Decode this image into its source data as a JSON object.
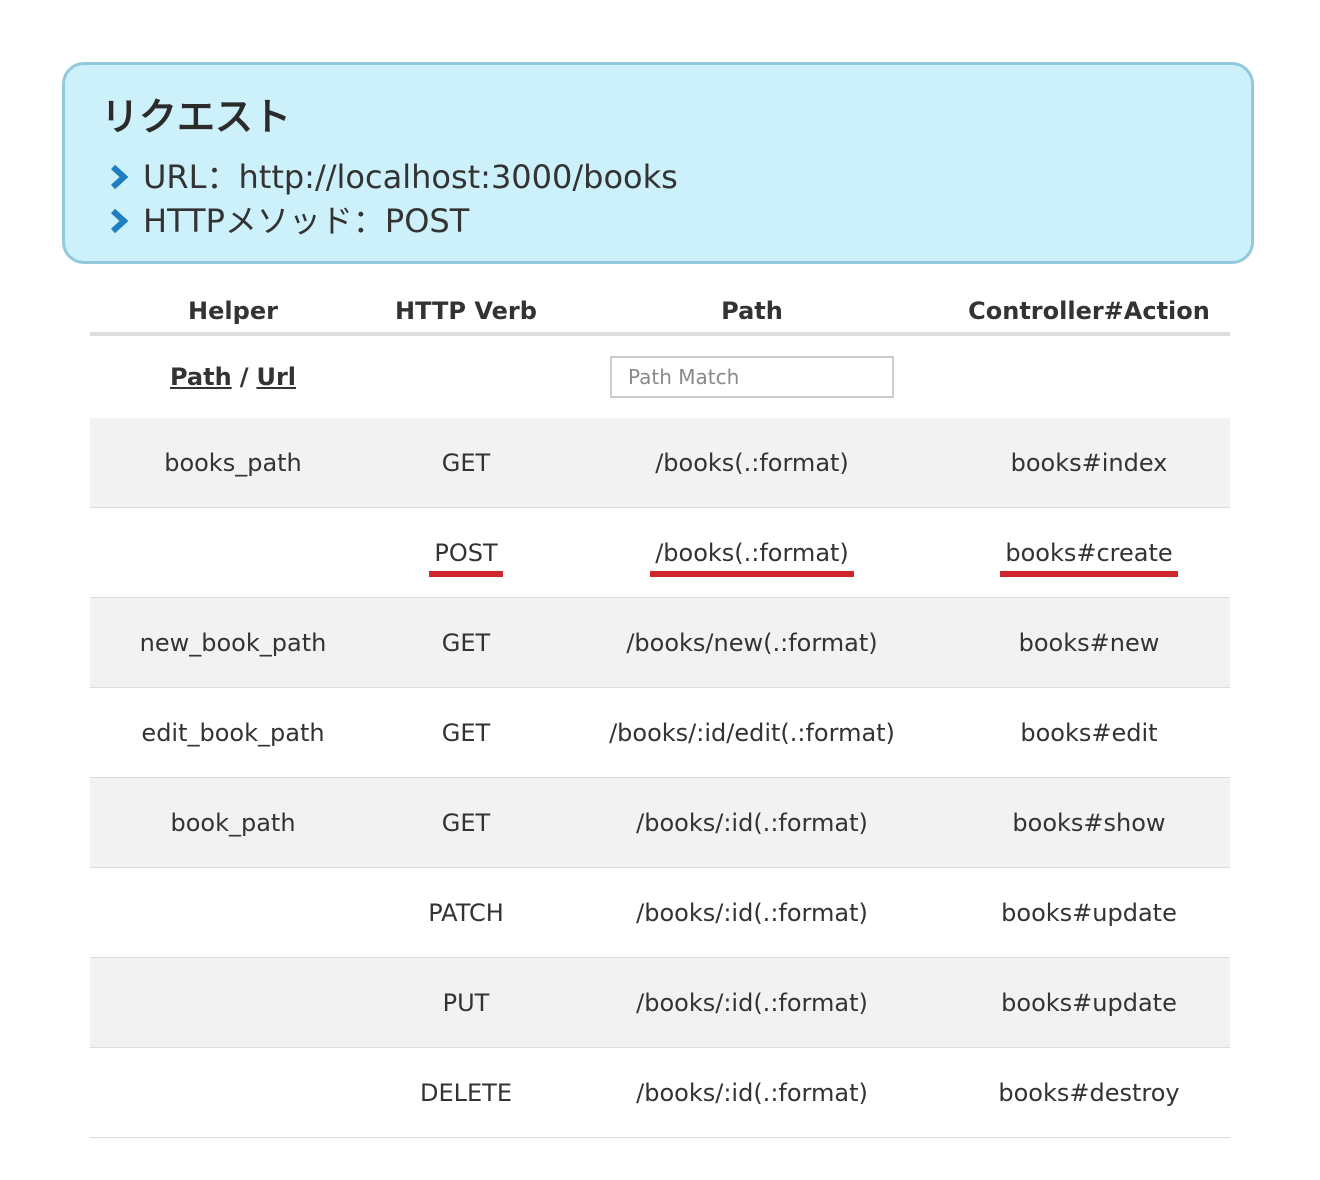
{
  "request": {
    "title": "リクエスト",
    "url_line": "URL：http://localhost:3000/books",
    "method_line": "HTTPメソッド：POST",
    "accent_color": "#1f7ebf",
    "bg_color": "#cdf1fa"
  },
  "table": {
    "headers": {
      "helper": "Helper",
      "verb": "HTTP Verb",
      "path": "Path",
      "action": "Controller#Action"
    },
    "toggle": {
      "path_label": "Path",
      "separator": "/",
      "url_label": "Url"
    },
    "search": {
      "placeholder": "Path Match"
    },
    "rows": [
      {
        "helper": "books_path",
        "verb": "GET",
        "path": "/books(.:format)",
        "action": "books#index"
      },
      {
        "helper": "",
        "verb": "POST",
        "path": "/books(.:format)",
        "action": "books#create"
      },
      {
        "helper": "new_book_path",
        "verb": "GET",
        "path": "/books/new(.:format)",
        "action": "books#new"
      },
      {
        "helper": "edit_book_path",
        "verb": "GET",
        "path": "/books/:id/edit(.:format)",
        "action": "books#edit"
      },
      {
        "helper": "book_path",
        "verb": "GET",
        "path": "/books/:id(.:format)",
        "action": "books#show"
      },
      {
        "helper": "",
        "verb": "PATCH",
        "path": "/books/:id(.:format)",
        "action": "books#update"
      },
      {
        "helper": "",
        "verb": "PUT",
        "path": "/books/:id(.:format)",
        "action": "books#update"
      },
      {
        "helper": "",
        "verb": "DELETE",
        "path": "/books/:id(.:format)",
        "action": "books#destroy"
      }
    ],
    "highlight_color": "#d0262d"
  }
}
